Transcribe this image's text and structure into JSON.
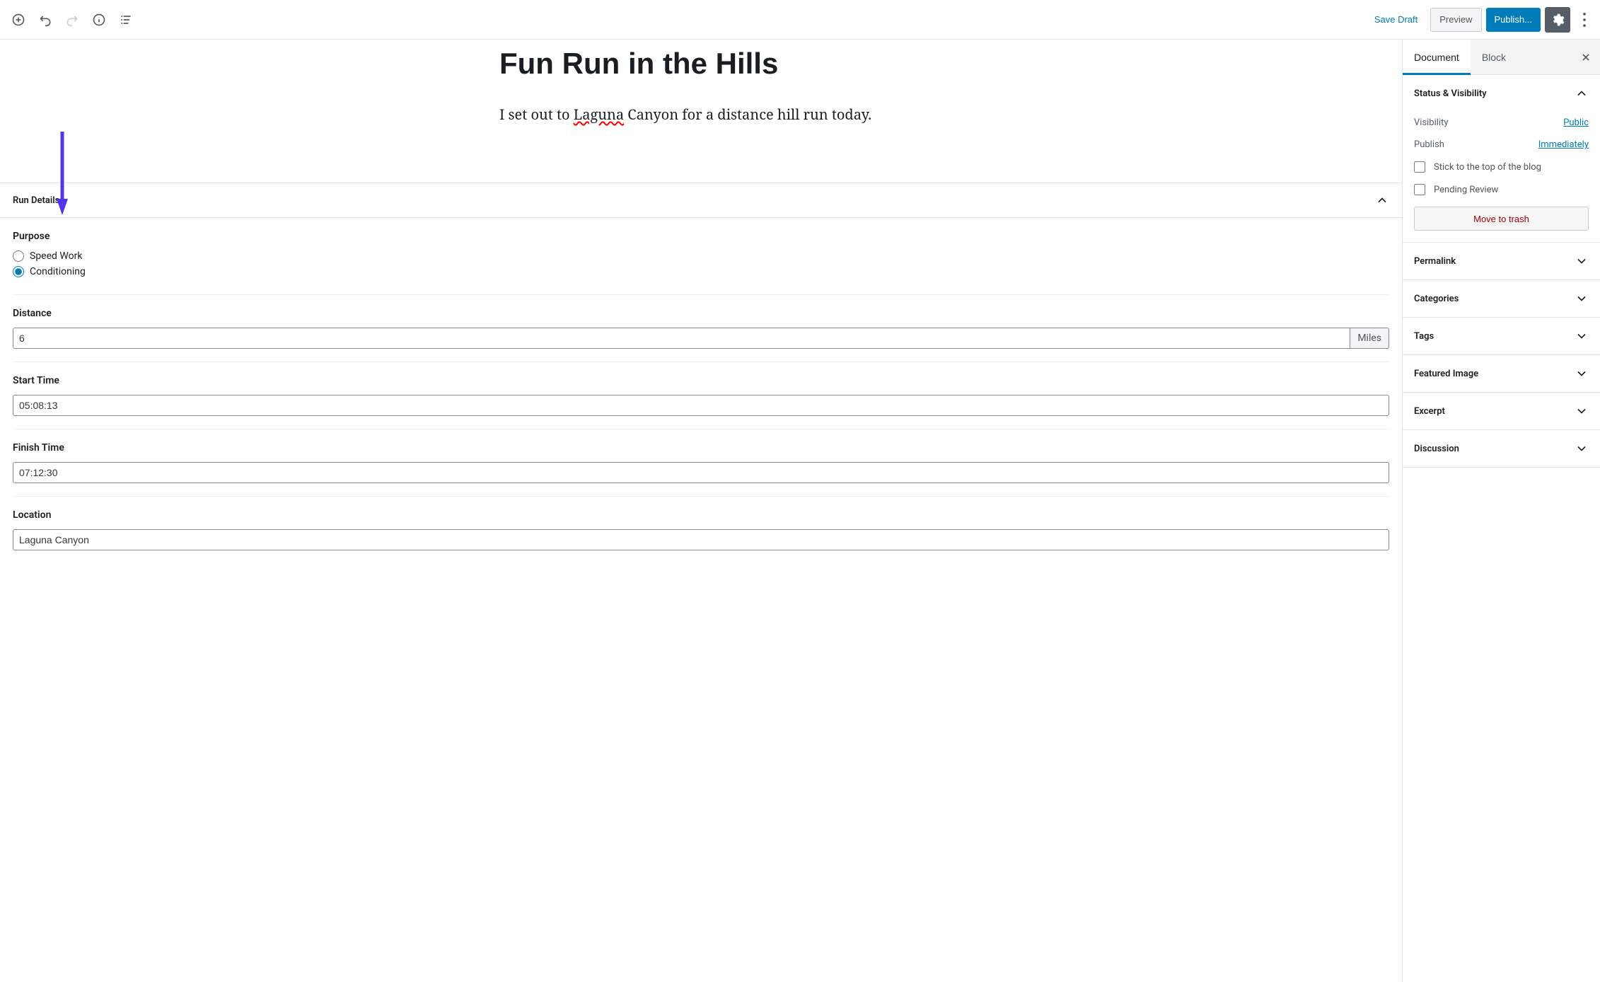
{
  "toolbar": {
    "save_draft": "Save Draft",
    "preview": "Preview",
    "publish": "Publish..."
  },
  "post": {
    "title": "Fun Run in the Hills",
    "body_pre": "I set out to ",
    "body_spell": "Laguna",
    "body_post": " Canyon for a distance hill run today."
  },
  "meta": {
    "section_title": "Run Details",
    "purpose": {
      "label": "Purpose",
      "opt_speed": "Speed Work",
      "opt_cond": "Conditioning",
      "selected": "Conditioning"
    },
    "distance": {
      "label": "Distance",
      "value": "6",
      "unit": "Miles"
    },
    "start_time": {
      "label": "Start Time",
      "value": "05:08:13"
    },
    "finish_time": {
      "label": "Finish Time",
      "value": "07:12:30"
    },
    "location": {
      "label": "Location",
      "value": "Laguna Canyon"
    }
  },
  "sidebar": {
    "tabs": {
      "document": "Document",
      "block": "Block"
    },
    "status": {
      "title": "Status & Visibility",
      "visibility_label": "Visibility",
      "visibility_value": "Public",
      "publish_label": "Publish",
      "publish_value": "Immediately",
      "stick": "Stick to the top of the blog",
      "pending": "Pending Review",
      "trash": "Move to trash"
    },
    "panels": {
      "permalink": "Permalink",
      "categories": "Categories",
      "tags": "Tags",
      "featured": "Featured Image",
      "excerpt": "Excerpt",
      "discussion": "Discussion"
    }
  }
}
